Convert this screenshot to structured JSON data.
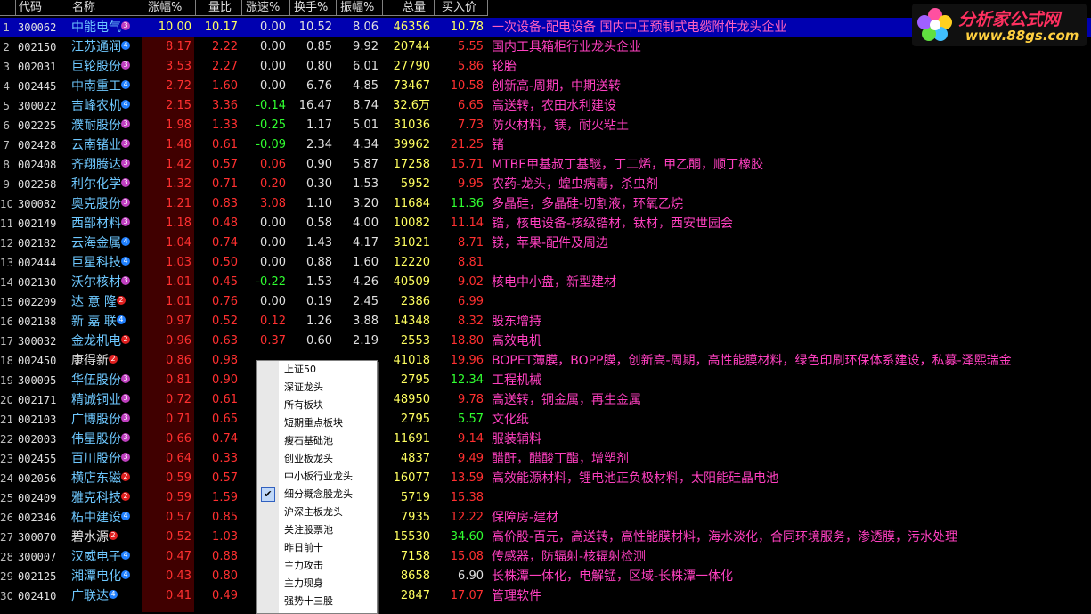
{
  "headers": {
    "idx": "",
    "code": "代码",
    "name": "名称",
    "zf": "涨幅%",
    "lb": "量比",
    "zs": "涨速%",
    "hs": "换手%",
    "zh": "振幅%",
    "zl": "总量",
    "mj": "买入价"
  },
  "rows": [
    {
      "idx": "1",
      "code": "300062",
      "name": "中能电气",
      "badge": "3",
      "zf": "10.00",
      "lb": "10.17",
      "zs": "0.00",
      "hs": "10.52",
      "zh": "8.06",
      "zl": "46356",
      "mj": "10.78",
      "note": "一次设备-配电设备 国内中压预制式电缆附件龙头企业",
      "zsc": "white",
      "mjc": "red"
    },
    {
      "idx": "2",
      "code": "002150",
      "name": "江苏通润",
      "badge": "4",
      "zf": "8.17",
      "lb": "2.22",
      "zs": "0.00",
      "hs": "0.85",
      "zh": "9.92",
      "zl": "20744",
      "mj": "5.55",
      "note": "国内工具箱柜行业龙头企业",
      "zsc": "white",
      "mjc": "red"
    },
    {
      "idx": "3",
      "code": "002031",
      "name": "巨轮股份",
      "badge": "3",
      "zf": "3.53",
      "lb": "2.27",
      "zs": "0.00",
      "hs": "0.80",
      "zh": "6.01",
      "zl": "27790",
      "mj": "5.86",
      "note": "轮胎",
      "zsc": "white",
      "mjc": "red"
    },
    {
      "idx": "4",
      "code": "002445",
      "name": "中南重工",
      "badge": "4",
      "zf": "2.72",
      "lb": "1.60",
      "zs": "0.00",
      "hs": "6.76",
      "zh": "4.85",
      "zl": "73467",
      "mj": "10.58",
      "note": "创新高-周期，中期送转",
      "zsc": "white",
      "mjc": "red"
    },
    {
      "idx": "5",
      "code": "300022",
      "name": "吉峰农机",
      "badge": "4",
      "zf": "2.15",
      "lb": "3.36",
      "zs": "-0.14",
      "hs": "16.47",
      "zh": "8.74",
      "zl": "32.6万",
      "mj": "6.65",
      "note": "高送转，农田水利建设",
      "zsc": "green",
      "mjc": "red"
    },
    {
      "idx": "6",
      "code": "002225",
      "name": "濮耐股份",
      "badge": "3",
      "zf": "1.98",
      "lb": "1.33",
      "zs": "-0.25",
      "hs": "1.17",
      "zh": "5.01",
      "zl": "31036",
      "mj": "7.73",
      "note": "防火材料，镁，耐火粘土",
      "zsc": "green",
      "mjc": "red"
    },
    {
      "idx": "7",
      "code": "002428",
      "name": "云南锗业",
      "badge": "3",
      "zf": "1.48",
      "lb": "0.61",
      "zs": "-0.09",
      "hs": "2.34",
      "zh": "4.34",
      "zl": "39962",
      "mj": "21.25",
      "note": "锗",
      "zsc": "green",
      "mjc": "red"
    },
    {
      "idx": "8",
      "code": "002408",
      "name": "齐翔腾达",
      "badge": "3",
      "zf": "1.42",
      "lb": "0.57",
      "zs": "0.06",
      "hs": "0.90",
      "zh": "5.87",
      "zl": "17258",
      "mj": "15.71",
      "note": "MTBE甲基叔丁基醚，丁二烯，甲乙酮，顺丁橡胶",
      "zsc": "red",
      "mjc": "red"
    },
    {
      "idx": "9",
      "code": "002258",
      "name": "利尔化学",
      "badge": "3",
      "zf": "1.32",
      "lb": "0.71",
      "zs": "0.20",
      "hs": "0.30",
      "zh": "1.53",
      "zl": "5952",
      "mj": "9.95",
      "note": "农药-龙头，蝗虫病毒，杀虫剂",
      "zsc": "red",
      "mjc": "red"
    },
    {
      "idx": "10",
      "code": "300082",
      "name": "奥克股份",
      "badge": "3",
      "zf": "1.21",
      "lb": "0.83",
      "zs": "3.08",
      "hs": "1.10",
      "zh": "3.20",
      "zl": "11684",
      "mj": "11.36",
      "note": "多晶硅，多晶硅-切割液，环氧乙烷",
      "zsc": "red",
      "mjc": "green"
    },
    {
      "idx": "11",
      "code": "002149",
      "name": "西部材料",
      "badge": "3",
      "zf": "1.18",
      "lb": "0.48",
      "zs": "0.00",
      "hs": "0.58",
      "zh": "4.00",
      "zl": "10082",
      "mj": "11.14",
      "note": "锆，核电设备-核级锆材，钛材，西安世园会",
      "zsc": "white",
      "mjc": "red"
    },
    {
      "idx": "12",
      "code": "002182",
      "name": "云海金属",
      "badge": "4",
      "zf": "1.04",
      "lb": "0.74",
      "zs": "0.00",
      "hs": "1.43",
      "zh": "4.17",
      "zl": "31021",
      "mj": "8.71",
      "note": "镁，苹果-配件及周边",
      "zsc": "white",
      "mjc": "red"
    },
    {
      "idx": "13",
      "code": "002444",
      "name": "巨星科技",
      "badge": "4",
      "zf": "1.03",
      "lb": "0.50",
      "zs": "0.00",
      "hs": "0.88",
      "zh": "1.60",
      "zl": "12220",
      "mj": "8.81",
      "note": "",
      "zsc": "white",
      "mjc": "red"
    },
    {
      "idx": "14",
      "code": "002130",
      "name": "沃尔核材",
      "badge": "3",
      "zf": "1.01",
      "lb": "0.45",
      "zs": "-0.22",
      "hs": "1.53",
      "zh": "4.26",
      "zl": "40509",
      "mj": "9.02",
      "note": "核电中小盘，新型建材",
      "zsc": "green",
      "mjc": "red"
    },
    {
      "idx": "15",
      "code": "002209",
      "name": "达 意 隆",
      "badge": "2",
      "zf": "1.01",
      "lb": "0.76",
      "zs": "0.00",
      "hs": "0.19",
      "zh": "2.45",
      "zl": "2386",
      "mj": "6.99",
      "note": "",
      "zsc": "white",
      "mjc": "red"
    },
    {
      "idx": "16",
      "code": "002188",
      "name": "新 嘉 联",
      "badge": "4",
      "zf": "0.97",
      "lb": "0.52",
      "zs": "0.12",
      "hs": "1.26",
      "zh": "3.88",
      "zl": "14348",
      "mj": "8.32",
      "note": "股东增持",
      "zsc": "red",
      "mjc": "red"
    },
    {
      "idx": "17",
      "code": "300032",
      "name": "金龙机电",
      "badge": "2",
      "zf": "0.96",
      "lb": "0.63",
      "zs": "0.37",
      "hs": "0.60",
      "zh": "2.19",
      "zl": "2553",
      "mj": "18.80",
      "note": "高效电机",
      "zsc": "red",
      "mjc": "red"
    },
    {
      "idx": "18",
      "code": "002450",
      "name": "康得新",
      "badge": "2",
      "zf": "0.86",
      "lb": "0.98",
      "zs": "",
      "hs": "",
      "zh": "",
      "zl": "41018",
      "mj": "19.96",
      "note": "BOPET薄膜，BOPP膜，创新高-周期，高性能膜材料，绿色印刷环保体系建设，私募-泽熙瑞金",
      "zsc": "white",
      "mjc": "red",
      "plain": true
    },
    {
      "idx": "19",
      "code": "300095",
      "name": "华伍股份",
      "badge": "3",
      "zf": "0.81",
      "lb": "0.90",
      "zs": "",
      "hs": "",
      "zh": "",
      "zl": "2795",
      "mj": "12.34",
      "note": "工程机械",
      "zsc": "white",
      "mjc": "green"
    },
    {
      "idx": "20",
      "code": "002171",
      "name": "精诚铜业",
      "badge": "3",
      "zf": "0.72",
      "lb": "0.61",
      "zs": "",
      "hs": "",
      "zh": "",
      "zl": "48950",
      "mj": "9.78",
      "note": "高送转，铜金属，再生金属",
      "zsc": "white",
      "mjc": "red"
    },
    {
      "idx": "21",
      "code": "002103",
      "name": "广博股份",
      "badge": "3",
      "zf": "0.71",
      "lb": "0.65",
      "zs": "",
      "hs": "",
      "zh": "",
      "zl": "2795",
      "mj": "5.57",
      "note": "文化纸",
      "zsc": "white",
      "mjc": "green"
    },
    {
      "idx": "22",
      "code": "002003",
      "name": "伟星股份",
      "badge": "3",
      "zf": "0.66",
      "lb": "0.74",
      "zs": "",
      "hs": "",
      "zh": "",
      "zl": "11691",
      "mj": "9.14",
      "note": "服装辅料",
      "zsc": "white",
      "mjc": "red"
    },
    {
      "idx": "23",
      "code": "002455",
      "name": "百川股份",
      "badge": "3",
      "zf": "0.64",
      "lb": "0.33",
      "zs": "",
      "hs": "",
      "zh": "",
      "zl": "4837",
      "mj": "9.49",
      "note": "醋酐，醋酸丁酯，增塑剂",
      "zsc": "white",
      "mjc": "red"
    },
    {
      "idx": "24",
      "code": "002056",
      "name": "横店东磁",
      "badge": "2",
      "zf": "0.59",
      "lb": "0.57",
      "zs": "",
      "hs": "",
      "zh": "",
      "zl": "16077",
      "mj": "13.59",
      "note": "高效能源材料，锂电池正负极材料，太阳能硅晶电池",
      "zsc": "white",
      "mjc": "red"
    },
    {
      "idx": "25",
      "code": "002409",
      "name": "雅克科技",
      "badge": "2",
      "zf": "0.59",
      "lb": "1.59",
      "zs": "",
      "hs": "",
      "zh": "",
      "zl": "5719",
      "mj": "15.38",
      "note": "",
      "zsc": "white",
      "mjc": "red"
    },
    {
      "idx": "26",
      "code": "002346",
      "name": "柘中建设",
      "badge": "4",
      "zf": "0.57",
      "lb": "0.85",
      "zs": "",
      "hs": "",
      "zh": "",
      "zl": "7935",
      "mj": "12.22",
      "note": "保障房-建材",
      "zsc": "white",
      "mjc": "red"
    },
    {
      "idx": "27",
      "code": "300070",
      "name": "碧水源",
      "badge": "2",
      "zf": "0.52",
      "lb": "1.03",
      "zs": "",
      "hs": "",
      "zh": "",
      "zl": "15530",
      "mj": "34.60",
      "note": "高价股-百元，高送转，高性能膜材料，海水淡化，合同环境服务，渗透膜，污水处理",
      "zsc": "white",
      "mjc": "green",
      "plain": true
    },
    {
      "idx": "28",
      "code": "300007",
      "name": "汉威电子",
      "badge": "4",
      "zf": "0.47",
      "lb": "0.88",
      "zs": "",
      "hs": "",
      "zh": "",
      "zl": "7158",
      "mj": "15.08",
      "note": "传感器，防辐射-核辐射检测",
      "zsc": "white",
      "mjc": "red"
    },
    {
      "idx": "29",
      "code": "002125",
      "name": "湘潭电化",
      "badge": "4",
      "zf": "0.43",
      "lb": "0.80",
      "zs": "",
      "hs": "",
      "zh": "",
      "zl": "8658",
      "mj": "6.90",
      "note": "长株潭一体化，电解锰，区域-长株潭一体化",
      "zsc": "white",
      "mjc": "white"
    },
    {
      "idx": "30",
      "code": "002410",
      "name": "广联达",
      "badge": "4",
      "zf": "0.41",
      "lb": "0.49",
      "zs": "",
      "hs": "",
      "zh": "",
      "zl": "2847",
      "mj": "17.07",
      "note": "管理软件",
      "zsc": "white",
      "mjc": "red"
    }
  ],
  "logo": {
    "title": "分析家公式网",
    "url": "www.88gs.com"
  },
  "menu": {
    "items": [
      "上证50",
      "深证龙头",
      "所有板块",
      "短期重点板块",
      "瘦石基础池",
      "创业板龙头",
      "中小板行业龙头",
      "细分概念股龙头",
      "沪深主板龙头",
      "关注股票池",
      "昨日前十",
      "主力攻击",
      "主力现身",
      "强势十三股"
    ],
    "checked_index": 7,
    "check_mark": "✔"
  },
  "colors": {
    "background": "#000000",
    "selected_row": "#0000b0",
    "note_text": "#ff40c0",
    "up": "#ff3030",
    "down": "#30ff30",
    "volume": "#ffff60",
    "name_text": "#6ec8ff"
  }
}
